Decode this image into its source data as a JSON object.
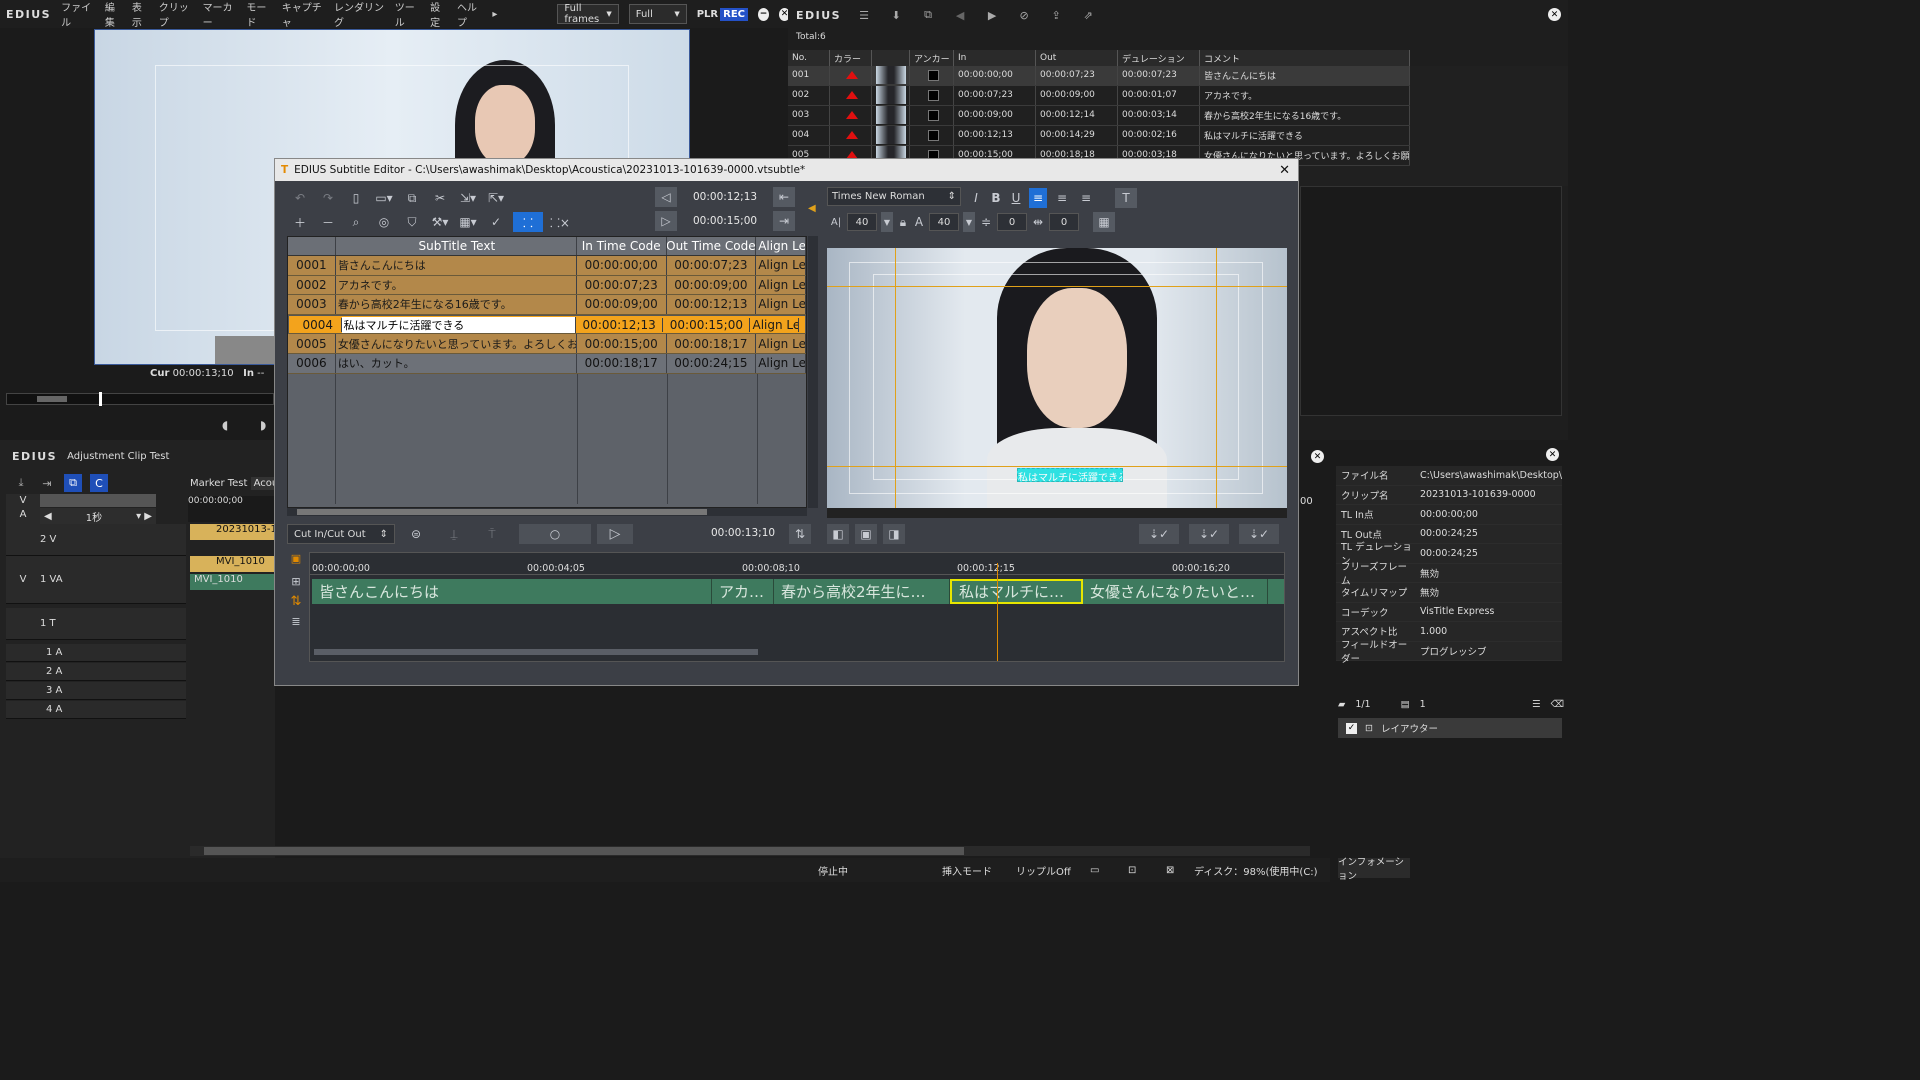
{
  "main_window": {
    "logo": "EDIUS",
    "menu": [
      "ファイル",
      "編集",
      "表示",
      "クリップ",
      "マーカー",
      "モード",
      "キャプチャ",
      "レンダリング",
      "ツール",
      "設定",
      "ヘルプ"
    ],
    "frames_select": "Full frames",
    "quality_select": "Full",
    "plr": "PLR",
    "rec": "REC"
  },
  "player": {
    "cur_label": "Cur",
    "cur_tc": "00:00:13;10",
    "in_label": "In",
    "in_tc": "--"
  },
  "marker_panel": {
    "logo": "EDIUS",
    "total": "Total:6",
    "headers": [
      "No.",
      "カラー",
      "",
      "アンカー",
      "In",
      "Out",
      "デュレーション",
      "コメント"
    ],
    "rows": [
      {
        "no": "001",
        "in": "00:00:00;00",
        "out": "00:00:07;23",
        "dur": "00:00:07;23",
        "comment": "皆さんこんにちは"
      },
      {
        "no": "002",
        "in": "00:00:07;23",
        "out": "00:00:09;00",
        "dur": "00:00:01;07",
        "comment": "アカネです。"
      },
      {
        "no": "003",
        "in": "00:00:09;00",
        "out": "00:00:12;14",
        "dur": "00:00:03;14",
        "comment": "春から高校2年生になる16歳です。"
      },
      {
        "no": "004",
        "in": "00:00:12;13",
        "out": "00:00:14;29",
        "dur": "00:00:02;16",
        "comment": "私はマルチに活躍できる"
      },
      {
        "no": "005",
        "in": "00:00:15;00",
        "out": "00:00:18;18",
        "dur": "00:00:03;18",
        "comment": "女優さんになりたいと思っています。よろしくお願いします"
      }
    ]
  },
  "subtitle_editor": {
    "title": "EDIUS Subtitle Editor - C:\\Users\\awashimak\\Desktop\\Acoustica\\20231013-101639-0000.vtsubtle*",
    "tc_in": "00:00:12;13",
    "tc_out": "00:00:15;00",
    "font": "Times New Roman",
    "size_a": "40",
    "size_b": "40",
    "spacing": "0",
    "offset": "0",
    "grid_headers": [
      "",
      "SubTitle Text",
      "In Time Code",
      "Out Time Code",
      "Align Le"
    ],
    "rows": [
      {
        "id": "0001",
        "text": "皆さんこんにちは",
        "in": "00:00:00;00",
        "out": "00:00:07;23",
        "align": "Align Le"
      },
      {
        "id": "0002",
        "text": "アカネです。",
        "in": "00:00:07;23",
        "out": "00:00:09;00",
        "align": "Align Le"
      },
      {
        "id": "0003",
        "text": "春から高校2年生になる16歳です。",
        "in": "00:00:09;00",
        "out": "00:00:12;13",
        "align": "Align Le"
      },
      {
        "id": "0004",
        "text": "私はマルチに活躍できる",
        "in": "00:00:12;13",
        "out": "00:00:15;00",
        "align": "Align Le"
      },
      {
        "id": "0005",
        "text": "女優さんになりたいと思っています。よろしくお願いし",
        "in": "00:00:15;00",
        "out": "00:00:18;17",
        "align": "Align Le"
      },
      {
        "id": "0006",
        "text": "はい、カット。",
        "in": "00:00:18;17",
        "out": "00:00:24;15",
        "align": "Align Le"
      }
    ],
    "cut_mode": "Cut In/Cut Out",
    "current_tc": "00:00:13;10",
    "ruler": [
      "00:00:00;00",
      "00:00:04;05",
      "00:00:08;10",
      "00:00:12;15",
      "00:00:16;20"
    ],
    "clips": [
      "皆さんこんにちは",
      "アカ…",
      "春から高校2年生に…",
      "私はマルチに…",
      "女優さんになりたいと…"
    ],
    "preview_caption": "私はマルチに活躍できる"
  },
  "timeline": {
    "logo": "EDIUS",
    "project": "Adjustment Clip Test",
    "ruler_tc": "00:00:00;00",
    "scale": "1秒",
    "marker_tab": "Marker Test",
    "acou_tab": "Acou",
    "tracks": [
      "2 V",
      "1 VA",
      "1 T",
      "1 A",
      "2 A",
      "3 A",
      "4 A"
    ],
    "clip_a": "20231013-1",
    "clip_b": "MVI_1010",
    "clip_c": "MVI_1010",
    "v_label": "V",
    "a_label": "A",
    "right_tc": "00"
  },
  "info_panel": {
    "rows": [
      {
        "k": "ファイル名",
        "v": "C:\\Users\\awashimak\\Desktop\\"
      },
      {
        "k": "クリップ名",
        "v": "20231013-101639-0000"
      },
      {
        "k": "TL In点",
        "v": "00:00:00;00"
      },
      {
        "k": "TL Out点",
        "v": "00:00:24;25"
      },
      {
        "k": "TL デュレーション",
        "v": "00:00:24;25"
      },
      {
        "k": "フリーズフレーム",
        "v": "無効"
      },
      {
        "k": "タイムリマップ",
        "v": "無効"
      },
      {
        "k": "コーデック",
        "v": "VisTitle Express"
      },
      {
        "k": "アスペクト比",
        "v": "1.000"
      },
      {
        "k": "フィールドオーダー",
        "v": "プログレッシブ"
      }
    ],
    "page": "1/1",
    "layer_count": "1",
    "layouter": "レイアウター",
    "tab": "インフォメーション"
  },
  "status": {
    "state": "停止中",
    "mode": "挿入モード",
    "ripple": "リップルOff",
    "disk": "ディスク：98%(使用中(C:)"
  }
}
